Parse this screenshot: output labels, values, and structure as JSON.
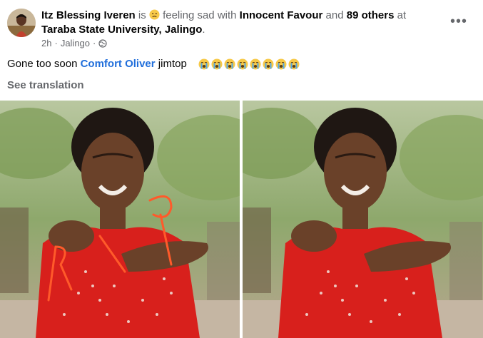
{
  "post": {
    "author": "Itz Blessing Iveren",
    "verb_is": "is",
    "feeling": "feeling sad",
    "with_word": "with",
    "tagged": "Innocent Favour",
    "and_word": "and",
    "others": "89 others",
    "at_word": "at",
    "place": "Taraba State University, Jalingo",
    "period": ".",
    "time": "2h",
    "location": "Jalingo",
    "separator": "·",
    "text_before": "Gone too soon",
    "mention": "Comfort Oliver",
    "text_after": "jimtop",
    "crying_emoji_count": 8,
    "see_translation": "See translation"
  },
  "colors": {
    "link": "#216fdb",
    "secondary": "#65676b",
    "dress": "#d8201c",
    "annotation": "#ff5a2a"
  },
  "icons": [
    "more-options-icon",
    "globe-icon",
    "sad-face-emoji-icon",
    "crying-emoji-icon"
  ],
  "photos": [
    {
      "annotation": "RIP",
      "has_annotation": true
    },
    {
      "has_annotation": false
    }
  ]
}
